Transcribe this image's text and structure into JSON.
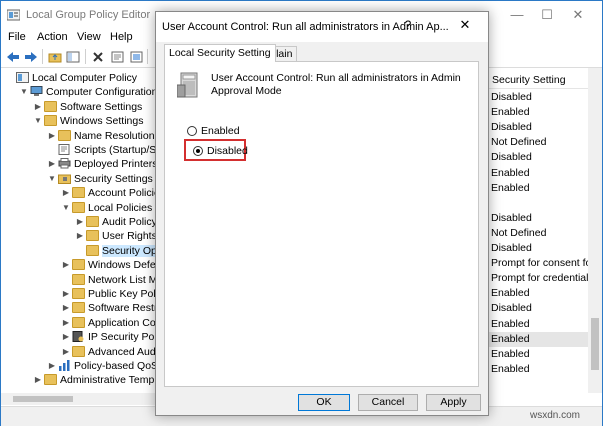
{
  "main_window": {
    "title": "Local Group Policy Editor",
    "controls": {
      "minimize": "—",
      "maximize": "☐",
      "close": "✕"
    }
  },
  "menu": [
    "File",
    "Action",
    "View",
    "Help"
  ],
  "tree": [
    {
      "label": "Local Computer Policy",
      "indent": 0,
      "expander": "",
      "icon": "computer-policy"
    },
    {
      "label": "Computer Configuration",
      "indent": 1,
      "expander": "expanded",
      "icon": "computer"
    },
    {
      "label": "Software Settings",
      "indent": 2,
      "expander": "collapsed",
      "icon": "folder"
    },
    {
      "label": "Windows Settings",
      "indent": 2,
      "expander": "expanded",
      "icon": "folder"
    },
    {
      "label": "Name Resolution Poli",
      "indent": 3,
      "expander": "collapsed",
      "icon": "folder"
    },
    {
      "label": "Scripts (Startup/Shutd",
      "indent": 3,
      "expander": "",
      "icon": "scripts"
    },
    {
      "label": "Deployed Printers",
      "indent": 3,
      "expander": "collapsed",
      "icon": "printer"
    },
    {
      "label": "Security Settings",
      "indent": 3,
      "expander": "expanded",
      "icon": "security"
    },
    {
      "label": "Account Policies",
      "indent": 4,
      "expander": "collapsed",
      "icon": "folder"
    },
    {
      "label": "Local Policies",
      "indent": 4,
      "expander": "expanded",
      "icon": "folder"
    },
    {
      "label": "Audit Policy",
      "indent": 5,
      "expander": "collapsed",
      "icon": "folder"
    },
    {
      "label": "User Rights As",
      "indent": 5,
      "expander": "collapsed",
      "icon": "folder"
    },
    {
      "label": "Security Optic",
      "indent": 5,
      "expander": "",
      "icon": "folder",
      "selected": true
    },
    {
      "label": "Windows Defende",
      "indent": 4,
      "expander": "collapsed",
      "icon": "folder"
    },
    {
      "label": "Network List Man",
      "indent": 4,
      "expander": "",
      "icon": "folder"
    },
    {
      "label": "Public Key Policie",
      "indent": 4,
      "expander": "collapsed",
      "icon": "folder"
    },
    {
      "label": "Software Restrictic",
      "indent": 4,
      "expander": "collapsed",
      "icon": "folder"
    },
    {
      "label": "Application Contr",
      "indent": 4,
      "expander": "collapsed",
      "icon": "folder"
    },
    {
      "label": "IP Security Policie",
      "indent": 4,
      "expander": "collapsed",
      "icon": "ipsec"
    },
    {
      "label": "Advanced Audit P",
      "indent": 4,
      "expander": "collapsed",
      "icon": "folder"
    },
    {
      "label": "Policy-based QoS",
      "indent": 3,
      "expander": "collapsed",
      "icon": "qos"
    },
    {
      "label": "Administrative Template",
      "indent": 2,
      "expander": "collapsed",
      "icon": "folder"
    }
  ],
  "list": {
    "header": "Security Setting",
    "rows": [
      "Disabled",
      "Enabled",
      "Disabled",
      "Not Defined",
      "Disabled",
      "Enabled",
      "Enabled",
      "",
      "Disabled",
      "Not Defined",
      "Disabled",
      "Prompt for consent for",
      "Prompt for credentials",
      "Enabled",
      "Disabled",
      "Enabled",
      "Enabled",
      "Enabled",
      "Enabled"
    ],
    "highlighted_row": 16
  },
  "dialog": {
    "title": "User Account Control: Run all administrators in Admin Ap...",
    "help": "?",
    "close": "✕",
    "tabs": [
      "Local Security Setting",
      "Explain"
    ],
    "policy_name": "User Account Control: Run all administrators in Admin Approval Mode",
    "options": [
      {
        "label": "Enabled",
        "selected": false
      },
      {
        "label": "Disabled",
        "selected": true
      }
    ],
    "buttons": {
      "ok": "OK",
      "cancel": "Cancel",
      "apply": "Apply"
    }
  },
  "watermark": "wsxdn.com",
  "colors": {
    "highlight_box": "#d32f2f",
    "selection": "#cce8ff",
    "folder": "#e8c15b"
  }
}
